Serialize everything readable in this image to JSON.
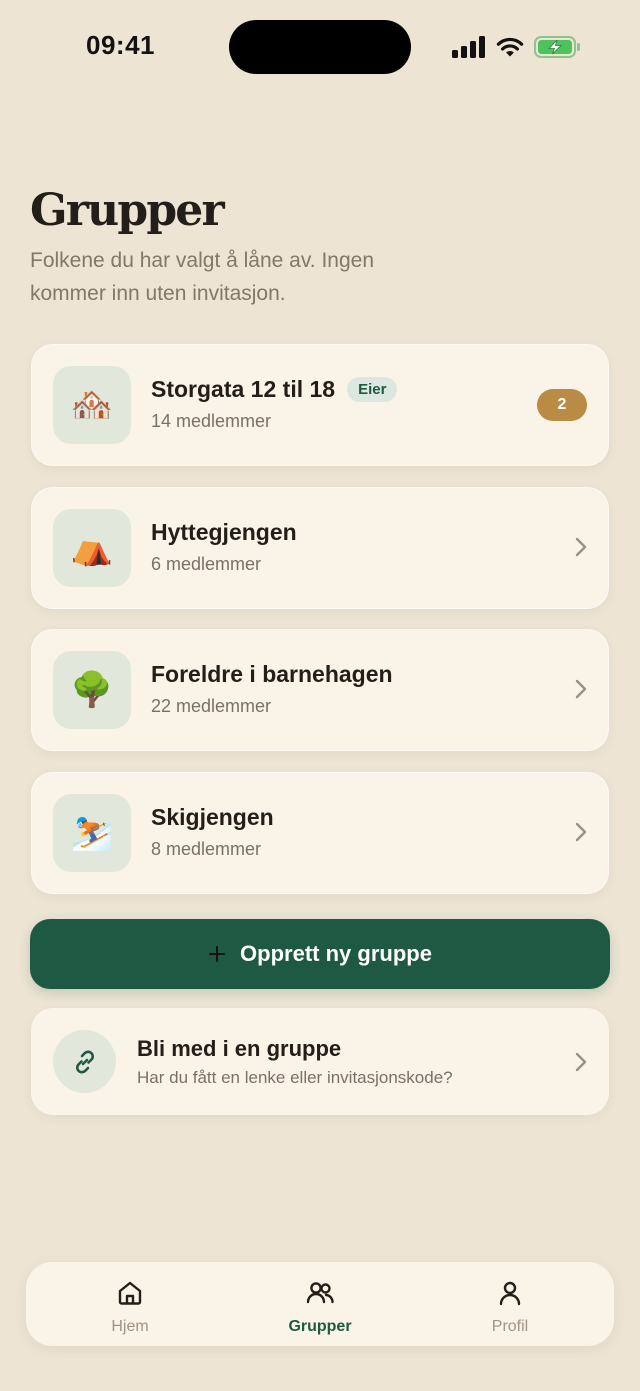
{
  "status_bar": {
    "time": "09:41"
  },
  "header": {
    "title": "Grupper",
    "subtitle": "Folkene du har valgt å låne av. Ingen kommer inn uten invitasjon."
  },
  "groups": [
    {
      "emoji": "🏘️",
      "name": "Storgata 12 til 18",
      "role": "Eier",
      "members": "14 medlemmer",
      "badge": "2"
    },
    {
      "emoji": "⛺",
      "name": "Hyttegjengen",
      "members": "6 medlemmer"
    },
    {
      "emoji": "🌳",
      "name": "Foreldre i barnehagen",
      "members": "22 medlemmer"
    },
    {
      "emoji": "⛷️",
      "name": "Skigjengen",
      "members": "8 medlemmer"
    }
  ],
  "create_button": {
    "label": "Opprett ny gruppe"
  },
  "join_card": {
    "title": "Bli med i en gruppe",
    "description": "Har du fått en lenke eller invitasjonskode?"
  },
  "tab_bar": {
    "tabs": [
      {
        "label": "Hjem",
        "icon": "home-icon",
        "active": false
      },
      {
        "label": "Grupper",
        "icon": "people-icon",
        "active": true
      },
      {
        "label": "Profil",
        "icon": "person-icon",
        "active": false
      }
    ]
  },
  "colors": {
    "background": "#ede4d4",
    "card": "#faf3e8",
    "accent_green": "#1e5a43",
    "badge_gold": "#b98b45",
    "avatar_bg": "#e2e7dc"
  }
}
